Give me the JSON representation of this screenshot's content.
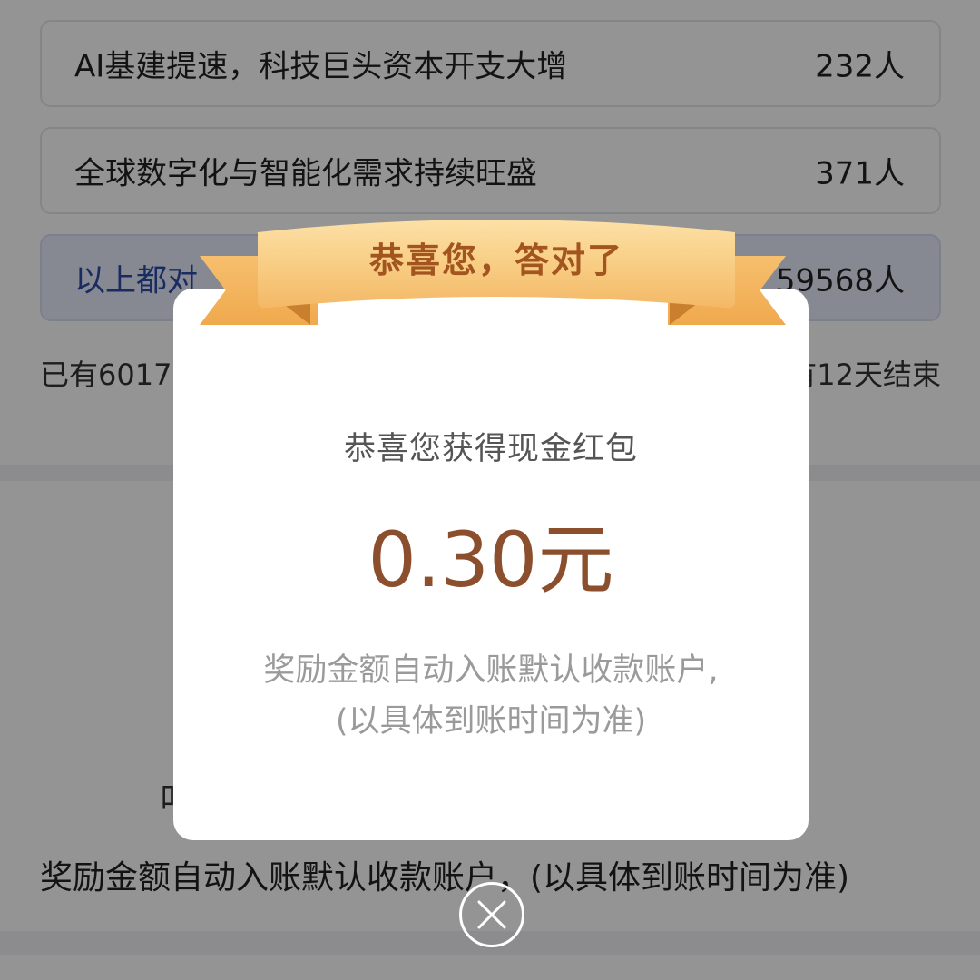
{
  "options": [
    {
      "text": "AI基建提速，科技巨头资本开支大增",
      "count": "232人"
    },
    {
      "text": "全球数字化与智能化需求持续旺盛",
      "count": "371人"
    },
    {
      "text": "以上都对",
      "count": "59568人"
    }
  ],
  "participants": {
    "left": "已有6017",
    "right": "有12天结束"
  },
  "background_partial_char": "叫",
  "background_reward_note": "奖励金额自动入账默认收款账户，(以具体到账时间为准)",
  "modal": {
    "banner_title": "恭喜您，答对了",
    "subtitle": "恭喜您获得现金红包",
    "amount": "0.30元",
    "note_line1": "奖励金额自动入账默认收款账户,",
    "note_line2": "(以具体到账时间为准)"
  },
  "close_icon": "close-icon",
  "colors": {
    "amount": "#8c4f2d",
    "banner_text": "#a3551f",
    "ribbon": "#f8cd83",
    "correct_option_bg": "#e7ecfb",
    "correct_option_text": "#2c4aa6"
  }
}
